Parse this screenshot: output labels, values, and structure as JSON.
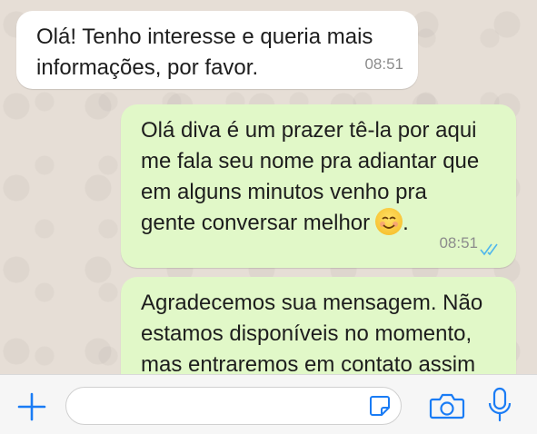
{
  "messages": [
    {
      "direction": "incoming",
      "lines": [
        "Olá! Tenho interesse e queria mais",
        "informações, por favor."
      ],
      "time": "08:51"
    },
    {
      "direction": "outgoing",
      "lines": [
        "Olá diva é um prazer tê-la por aqui",
        "me fala seu nome pra adiantar que",
        "em alguns minutos venho pra",
        "gente conversar melhor"
      ],
      "emoji": "smiling-face-emoji",
      "trailing": ".",
      "time": "08:51",
      "status": "read-double-check"
    },
    {
      "direction": "outgoing",
      "lines": [
        "Agradecemos sua mensagem. Não",
        "estamos disponíveis no momento,",
        "mas entraremos em contato assim"
      ]
    }
  ],
  "composer": {
    "placeholder": ""
  },
  "icons": [
    "plus-icon",
    "sticker-icon",
    "camera-icon",
    "microphone-icon"
  ],
  "colors": {
    "accent": "#1a7cf5",
    "outgoing_bubble": "#e1f8c8",
    "incoming_bubble": "#ffffff",
    "chat_background": "#e6ded6",
    "read_ticks": "#4fb6ec"
  }
}
